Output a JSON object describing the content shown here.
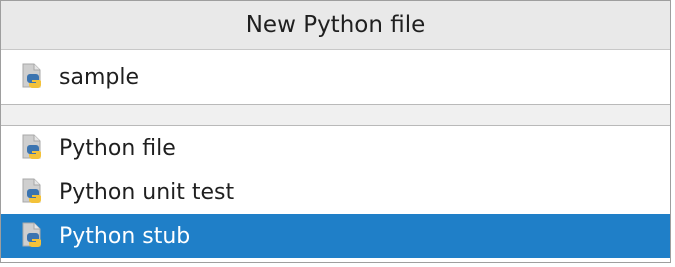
{
  "dialog": {
    "title": "New Python file"
  },
  "name_field": {
    "value": "sample",
    "icon": "python-file-icon"
  },
  "templates": [
    {
      "label": "Python file",
      "icon": "python-file-icon",
      "selected": false
    },
    {
      "label": "Python unit test",
      "icon": "python-file-icon",
      "selected": false
    },
    {
      "label": "Python stub",
      "icon": "python-file-icon",
      "selected": true
    }
  ],
  "colors": {
    "selection": "#1f7fc8",
    "title_bar": "#e9e9e9",
    "python_blue": "#3b74b0",
    "python_yellow": "#f3c23a"
  }
}
